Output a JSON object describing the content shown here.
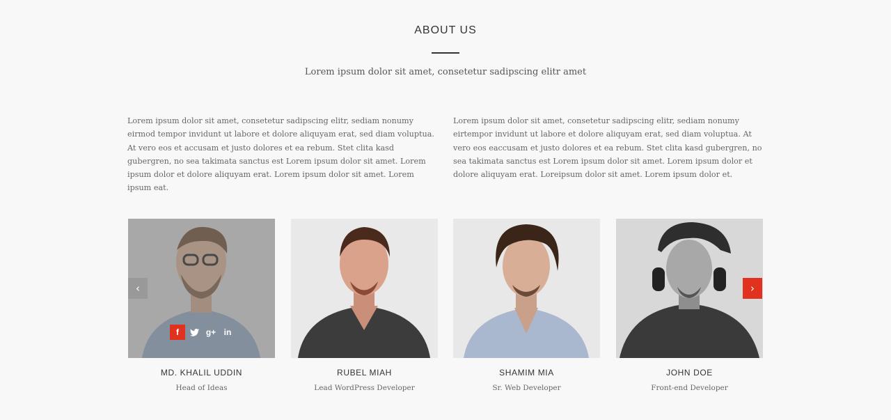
{
  "section": {
    "title": "ABOUT US",
    "subtitle": "Lorem ipsum dolor sit amet, consetetur sadipscing elitr amet"
  },
  "about": {
    "left_text": "Lorem ipsum dolor sit amet, consetetur sadipscing elitr, sediam nonumy eirmod tempor invidunt ut labore et dolore aliquyam erat, sed diam voluptua. At vero eos et accusam et justo dolores et ea rebum. Stet clita kasd gubergren, no sea takimata sanctus est Lorem ipsum dolor sit amet. Lorem ipsum dolor et dolore aliquyam erat. Lorem ipsum dolor sit amet. Lorem ipsum eat.",
    "right_text": "Lorem ipsum dolor sit amet, consetetur sadipscing elitr, sediam nonumy eirtempor invidunt ut labore et dolore aliquyam erat, sed diam voluptua. At vero eos eaccusam et justo dolores et ea rebum. Stet clita kasd gubergren, no sea takimata sanctus est Lorem ipsum dolor sit amet. Lorem ipsum dolor et dolore aliquyam erat. Loreipsum dolor sit amet. Lorem ipsum dolor et."
  },
  "team": {
    "members": [
      {
        "name": "MD. KHALIL UDDIN",
        "role": "Head of Ideas"
      },
      {
        "name": "RUBEL MIAH",
        "role": "Lead WordPress Developer"
      },
      {
        "name": "SHAMIM MIA",
        "role": "Sr. Web Developer"
      },
      {
        "name": "JOHN DOE",
        "role": "Front-end Developer"
      }
    ],
    "socials": [
      {
        "icon": "facebook-icon",
        "glyph": "f"
      },
      {
        "icon": "twitter-icon",
        "glyph": "🐦"
      },
      {
        "icon": "google-plus-icon",
        "glyph": "g+"
      },
      {
        "icon": "linkedin-icon",
        "glyph": "in"
      }
    ]
  },
  "carousel": {
    "prev_glyph": "‹",
    "next_glyph": "›"
  },
  "colors": {
    "accent": "#e0321f",
    "background": "#f8f8f8"
  }
}
